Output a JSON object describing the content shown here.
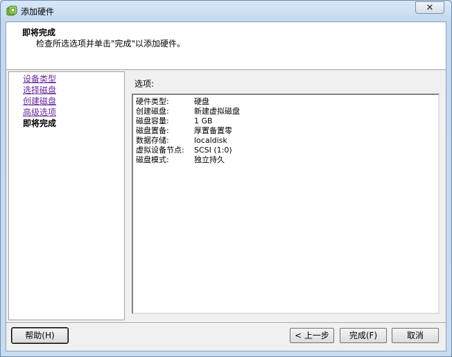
{
  "window": {
    "title": "添加硬件",
    "close_glyph": "✕"
  },
  "header": {
    "title": "即将完成",
    "description": "检查所选选项并单击\"完成\"以添加硬件。"
  },
  "nav": {
    "items": [
      {
        "label": "设备类型",
        "state": "visited"
      },
      {
        "label": "选择磁盘",
        "state": "visited"
      },
      {
        "label": "创建磁盘",
        "state": "visited"
      },
      {
        "label": "高级选项",
        "state": "visited"
      },
      {
        "label": "即将完成",
        "state": "current"
      }
    ]
  },
  "options": {
    "label": "选项:",
    "rows": [
      {
        "key": "硬件类型:",
        "value": "硬盘"
      },
      {
        "key": "创建磁盘:",
        "value": "新建虚拟磁盘"
      },
      {
        "key": "磁盘容量:",
        "value": "1 GB"
      },
      {
        "key": "磁盘置备:",
        "value": "厚置备置零"
      },
      {
        "key": "数据存储:",
        "value": "localdisk"
      },
      {
        "key": "虚拟设备节点:",
        "value": "SCSI (1:0)"
      },
      {
        "key": "磁盘模式:",
        "value": "独立持久"
      }
    ]
  },
  "buttons": {
    "help": "帮助(H)",
    "back": "< 上一步",
    "finish": "完成(F)",
    "cancel": "取消"
  },
  "icons": {
    "app": "add-hardware-icon",
    "close": "close-icon"
  },
  "colors": {
    "visited_link": "#6a2a9a",
    "titlebar": "#c3d8ef"
  }
}
